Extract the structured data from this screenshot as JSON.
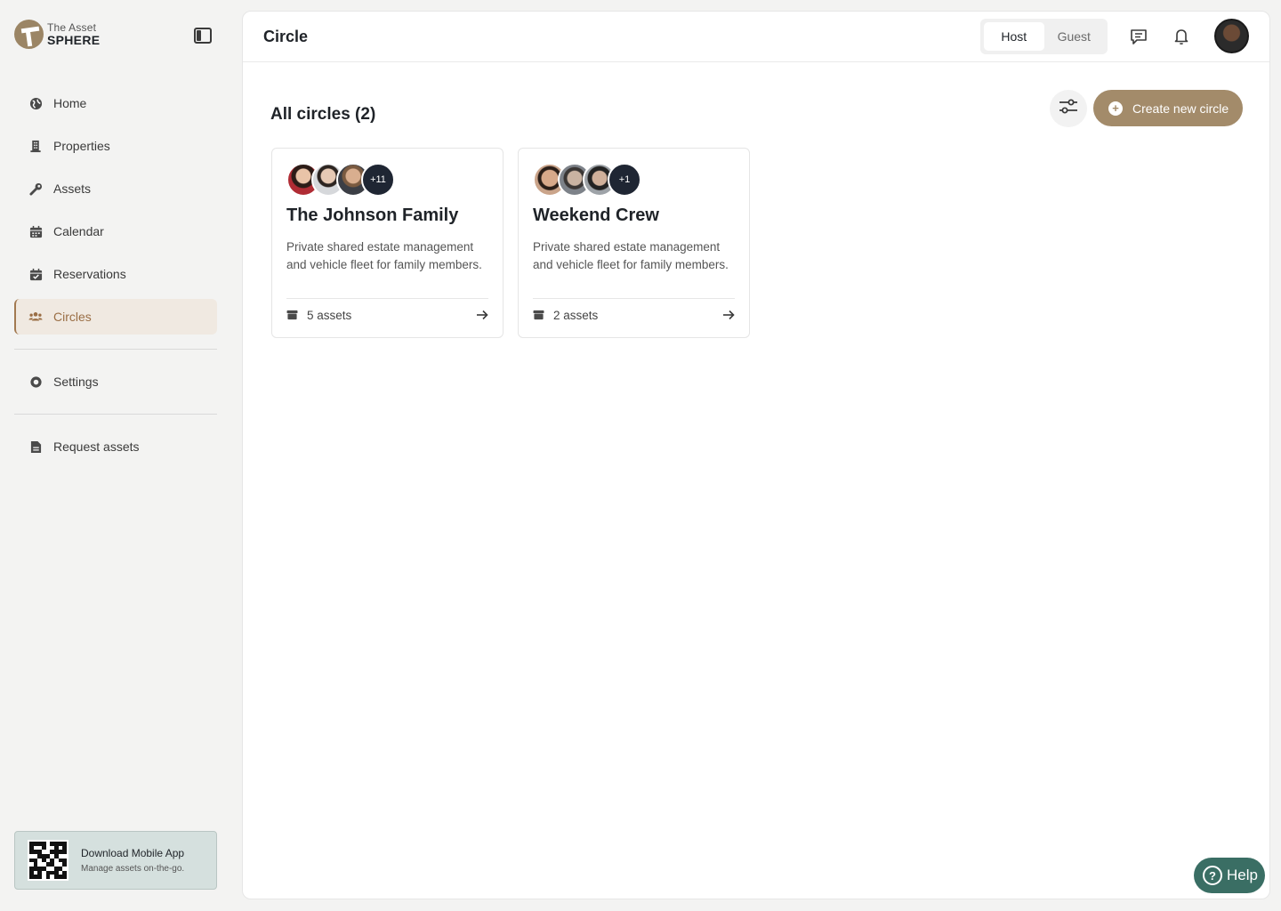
{
  "brand": {
    "line1": "The Asset",
    "line2": "SPHERE"
  },
  "sidebar": {
    "items": [
      {
        "label": "Home",
        "icon": "globe-icon"
      },
      {
        "label": "Properties",
        "icon": "building-icon"
      },
      {
        "label": "Assets",
        "icon": "wrench-icon"
      },
      {
        "label": "Calendar",
        "icon": "calendar-icon"
      },
      {
        "label": "Reservations",
        "icon": "calendar-check-icon"
      },
      {
        "label": "Circles",
        "icon": "users-icon",
        "active": true
      }
    ],
    "settings": {
      "label": "Settings",
      "icon": "gear-icon"
    },
    "request": {
      "label": "Request assets",
      "icon": "document-icon"
    },
    "promo": {
      "title": "Download Mobile App",
      "subtitle": "Manage assets on-the-go."
    }
  },
  "header": {
    "title": "Circle",
    "mode_options": [
      "Host",
      "Guest"
    ],
    "mode_selected": "Host"
  },
  "main": {
    "section_title": "All circles (2)",
    "create_label": "Create new circle",
    "cards": [
      {
        "title": "The Johnson Family",
        "description": "Private shared estate management and vehicle fleet for family members.",
        "extra_members": "+11",
        "assets": "5 assets",
        "avatar_colors": [
          "#b02c34",
          "#c9ccd0",
          "#5b4a3f"
        ]
      },
      {
        "title": "Weekend Crew",
        "description": "Private shared estate management and vehicle fleet for family members.",
        "extra_members": "+1",
        "assets": "2 assets",
        "avatar_colors": [
          "#caa48a",
          "#7d8289",
          "#9ea3a8"
        ]
      }
    ]
  },
  "help": {
    "label": "Help"
  },
  "colors": {
    "accent": "#a38b6a",
    "active_nav_bg": "#f0e9e1",
    "help": "#3a6e64"
  }
}
